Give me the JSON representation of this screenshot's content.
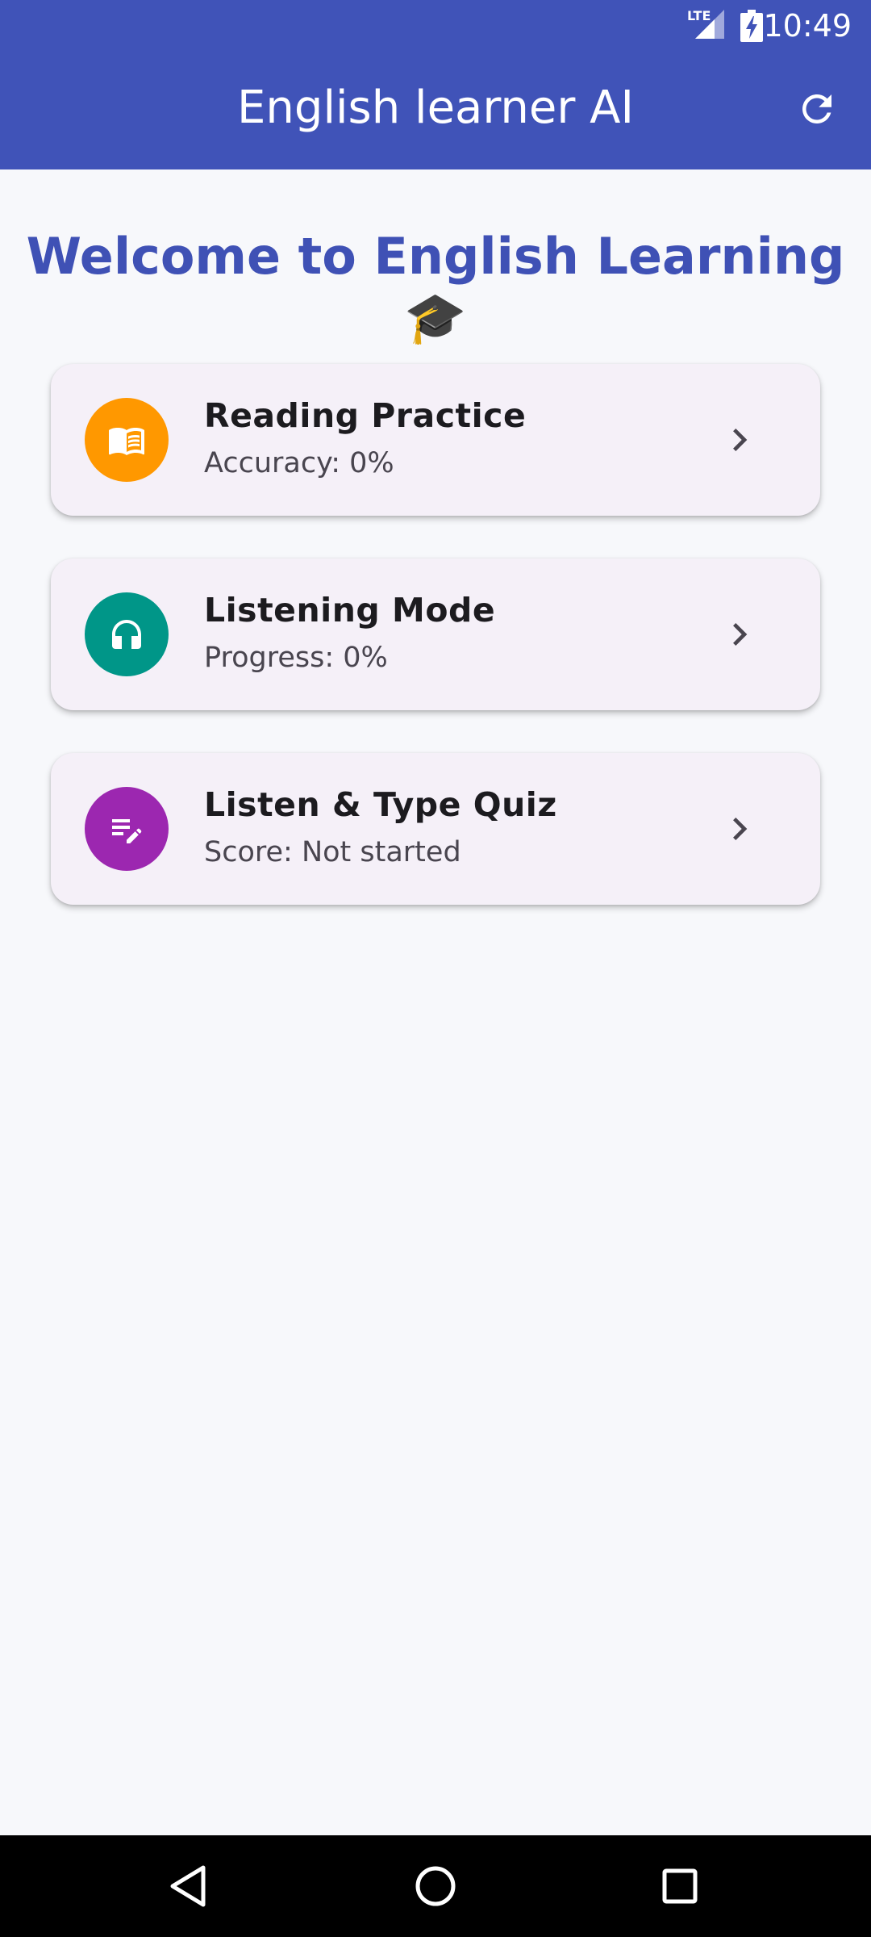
{
  "status_bar": {
    "time": "10:49",
    "network": "LTE"
  },
  "app_bar": {
    "title": "English learner AI",
    "refresh_icon": "refresh-icon",
    "color": "#4053B8"
  },
  "welcome": {
    "text": "Welcome to English Learning 🎓"
  },
  "cards": [
    {
      "title": "Reading Practice",
      "subtitle": "Accuracy: 0%",
      "icon": "book-icon",
      "icon_color": "#FF9800"
    },
    {
      "title": "Listening Mode",
      "subtitle": "Progress: 0%",
      "icon": "headphones-icon",
      "icon_color": "#009688"
    },
    {
      "title": "Listen & Type Quiz",
      "subtitle": "Score: Not started",
      "icon": "edit-note-icon",
      "icon_color": "#9C27B0"
    }
  ],
  "nav_bar": {
    "back_icon": "back-triangle-icon",
    "home_icon": "home-circle-icon",
    "recents_icon": "recents-square-icon"
  }
}
